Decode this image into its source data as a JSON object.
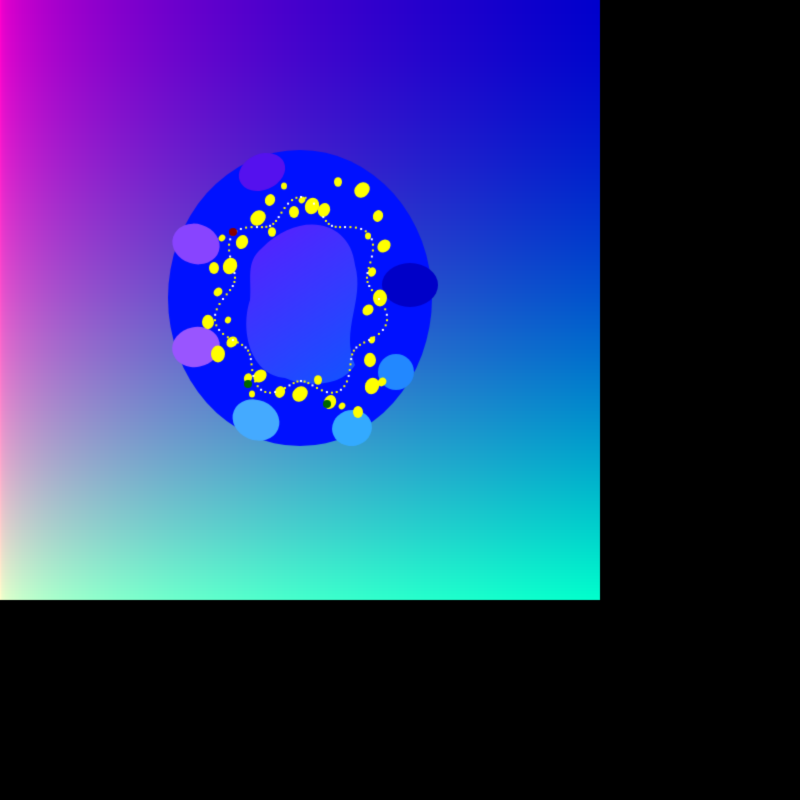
{
  "image": {
    "kind": "fractal-render",
    "description_colors": {
      "background": "#000000",
      "corner_top_left": "#ff00cc",
      "corner_top_right": "#0000cc",
      "corner_bottom_left": "#ffffcc",
      "corner_bottom_right": "#00ffcc",
      "set_body": "#0011ff",
      "set_interior_inner": "#3322ff",
      "bulb_highlight": "#ffff00",
      "bulb_dark_red": "#880000",
      "bulb_dark_green": "#006600",
      "lobe_violet": "#9955ff",
      "lobe_sky": "#44aaff"
    },
    "rendered_fraction_of_canvas": 0.75
  }
}
